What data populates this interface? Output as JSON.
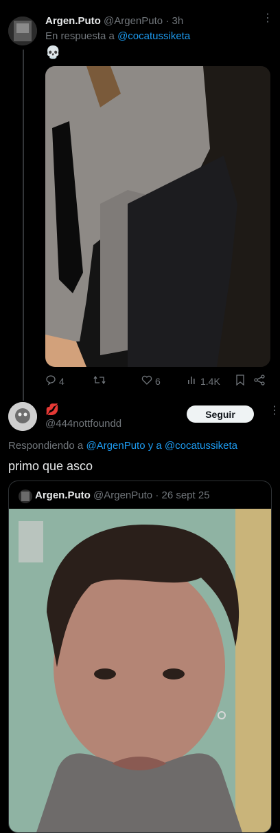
{
  "tweet1": {
    "name": "Argen.Puto",
    "handle": "@ArgenPuto",
    "time": "· 3h",
    "reply_prefix": "En respuesta a",
    "reply_to": "@cocatussiketa",
    "text": "💀",
    "stats": {
      "replies": "4",
      "likes": "6",
      "views": "1.4K"
    }
  },
  "tweet2": {
    "name_emoji": "💋",
    "handle": "@444nottfoundd",
    "follow_label": "Seguir",
    "reply_prefix": "Respondiendo a",
    "reply_to": "@ArgenPuto y a @cocatussiketa",
    "text": "primo que asco",
    "quote": {
      "name": "Argen.Puto",
      "handle": "@ArgenPuto",
      "time": "· 26 sept 25"
    }
  },
  "icons": [
    "more-icon",
    "reply-icon",
    "retweet-icon",
    "like-icon",
    "views-icon",
    "bookmark-icon",
    "share-icon"
  ]
}
